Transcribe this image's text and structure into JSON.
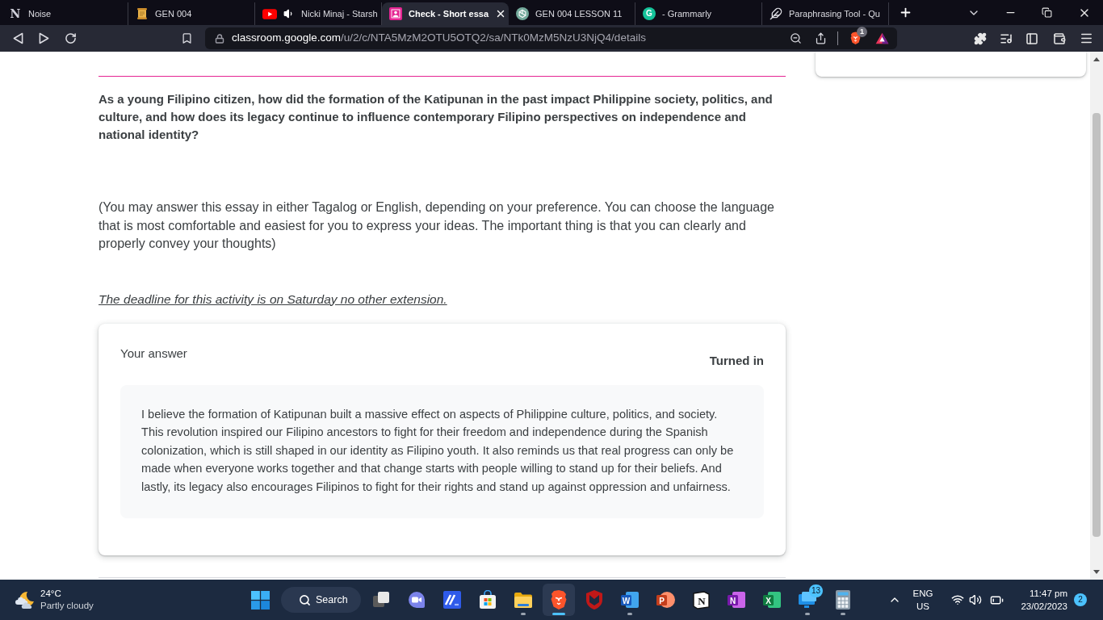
{
  "tabs": [
    {
      "title": "Noise",
      "kind": "letter",
      "icon_text": "N",
      "audio": false,
      "selected": false
    },
    {
      "title": "GEN 004",
      "kind": "scroll",
      "audio": false,
      "selected": false
    },
    {
      "title": "Nicki Minaj - Starsh",
      "kind": "video",
      "audio": true,
      "selected": false
    },
    {
      "title": "Check - Short essa",
      "kind": "person",
      "audio": false,
      "selected": true
    },
    {
      "title": "GEN 004 LESSON 11",
      "kind": "knot",
      "audio": false,
      "selected": false
    },
    {
      "title": "- Grammarly",
      "kind": "circle_letter",
      "icon_text": "G",
      "audio": false,
      "selected": false
    },
    {
      "title": "Paraphrasing Tool - Qu",
      "kind": "feather",
      "audio": false,
      "selected": false
    }
  ],
  "address_bar": {
    "host": "classroom.google.com",
    "path": "/u/2/c/NTA5MzM2OTU5OTQ2/sa/NTk0MzM5NzU3NjQ4/details",
    "shield_count": "1"
  },
  "assignment": {
    "question": "As a young Filipino citizen, how did the formation of the Katipunan in the past impact Philippine society, politics, and culture, and how does its legacy continue to influence contemporary Filipino perspectives on independence and national identity?",
    "instructions": "(You may answer this essay in either Tagalog or English, depending on your preference. You can choose the language that is most comfortable and easiest for you to express your ideas. The important thing is that you can clearly and properly convey your thoughts)",
    "deadline_note": "The deadline for this activity is on Saturday no other extension."
  },
  "answer_card": {
    "heading": "Your answer",
    "status": "Turned in",
    "answer": "I believe the formation of Katipunan built a massive effect on aspects of Philippine culture, politics, and society. This revolution inspired our Filipino ancestors to fight for their freedom and independence during the Spanish colonization, which is still shaped in our identity as Filipino youth. It also reminds us that real progress can only be made when everyone works together and that change starts with people willing to stand up for their beliefs. And lastly, its legacy also encourages Filipinos to fight for their rights and stand up against oppression and unfairness."
  },
  "taskbar": {
    "weather": {
      "temperature": "24°C",
      "condition": "Partly cloudy"
    },
    "search_label": "Search",
    "apps": [
      {
        "kind": "task_view",
        "running": false,
        "selected": false
      },
      {
        "kind": "chat",
        "running": false,
        "selected": false
      },
      {
        "kind": "stripes",
        "running": false,
        "selected": false
      },
      {
        "kind": "store",
        "running": false,
        "selected": false
      },
      {
        "kind": "folder",
        "running": true,
        "selected": false
      },
      {
        "kind": "lion",
        "running": true,
        "selected": true
      },
      {
        "kind": "shield",
        "running": false,
        "selected": false
      },
      {
        "kind": "word_tile",
        "glyph": "W",
        "running": true,
        "selected": false
      },
      {
        "kind": "slides_circle",
        "glyph": "P",
        "running": false,
        "selected": false
      },
      {
        "kind": "cube",
        "glyph": "N",
        "running": false,
        "selected": false
      },
      {
        "kind": "note_tile",
        "glyph": "N",
        "running": false,
        "selected": false
      },
      {
        "kind": "sheet_tile",
        "glyph": "X",
        "running": false,
        "selected": false
      },
      {
        "kind": "monitor",
        "badge": "13",
        "running": true,
        "selected": false
      },
      {
        "kind": "calculator",
        "running": true,
        "selected": false
      }
    ],
    "tray": {
      "language": "ENG",
      "region": "US",
      "time": "11:47 pm",
      "date": "23/02/2023",
      "notifications": "2"
    }
  }
}
